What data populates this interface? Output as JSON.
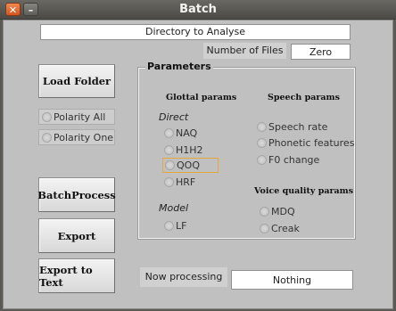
{
  "window": {
    "title": "Batch",
    "close_icon": "close-icon",
    "minimize_icon": "minimize-icon"
  },
  "directory_field": "Directory to Analyse",
  "files": {
    "label": "Number of Files",
    "value": "Zero"
  },
  "buttons": {
    "load_folder": "Load Folder",
    "batch_process": "BatchProcess",
    "export": "Export",
    "export_text": "Export to Text"
  },
  "polarity": {
    "all": "Polarity All",
    "one": "Polarity One"
  },
  "parameters": {
    "title": "Parameters",
    "glottal_header": "Glottal params",
    "speech_header": "Speech params",
    "voice_header": "Voice quality params",
    "direct_label": "Direct",
    "model_label": "Model",
    "glottal_direct": [
      "NAQ",
      "H1H2",
      "QOQ",
      "HRF"
    ],
    "glottal_model": [
      "LF"
    ],
    "speech": [
      "Speech rate",
      "Phonetic features",
      "F0 change"
    ],
    "voice": [
      "MDQ",
      "Creak"
    ]
  },
  "processing": {
    "label": "Now processing",
    "value": "Nothing"
  }
}
